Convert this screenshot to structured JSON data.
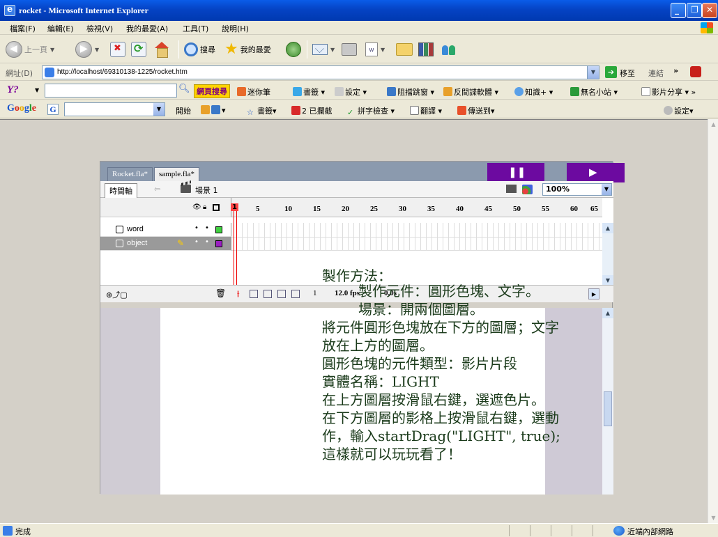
{
  "window": {
    "title": "rocket - Microsoft Internet Explorer"
  },
  "menu": [
    "檔案(F)",
    "編輯(E)",
    "檢視(V)",
    "我的最愛(A)",
    "工具(T)",
    "說明(H)"
  ],
  "toolbar": {
    "back_label": "上一頁",
    "search_label": "搜尋",
    "favorites_label": "我的最愛"
  },
  "address": {
    "label": "網址(D)",
    "url": "http://localhost/69310138-1225/rocket.htm",
    "go_label": "移至",
    "links_label": "連結"
  },
  "yahoo": {
    "logo": "Y?",
    "search_label": "網頁搜尋",
    "items": [
      "迷你筆",
      "書籤",
      "設定",
      "阻擋跳窗",
      "反間諜軟體",
      "知識+",
      "無名小站",
      "影片分享"
    ]
  },
  "google": {
    "items": [
      "開始",
      "書籤",
      "2 已攔截",
      "拼字檢查",
      "翻譯",
      "傳送到",
      "設定"
    ]
  },
  "flash": {
    "tabs": [
      "Rocket.fla*",
      "sample.fla*"
    ],
    "timeline_button": "時間軸",
    "scene_label": "場景 1",
    "zoom": "100%",
    "ruler": [
      "1",
      "5",
      "10",
      "15",
      "20",
      "25",
      "30",
      "35",
      "40",
      "45",
      "50",
      "55",
      "60",
      "65"
    ],
    "layers": [
      {
        "name": "word"
      },
      {
        "name": "object"
      }
    ],
    "frame_number": "1",
    "fps": "12.0 fps",
    "seconds": "0.0s"
  },
  "instructions": {
    "heading": "製作方法：",
    "lines": [
      "製作元件：圓形色塊、文字。",
      "場景：開兩個圖層。",
      "將元件圓形色塊放在下方的圖層；文字",
      "放在上方的圖層。",
      "圓形色塊的元件類型：影片片段",
      "實體名稱：LIGHT",
      "在上方圖層按滑鼠右鍵，選遮色片。",
      "在下方圖層的影格上按滑鼠右鍵，選動",
      "作，輸入startDrag(\"LIGHT\", true);",
      "這樣就可以玩玩看了！"
    ]
  },
  "status": {
    "text": "完成",
    "zone": "近端內部網路"
  }
}
